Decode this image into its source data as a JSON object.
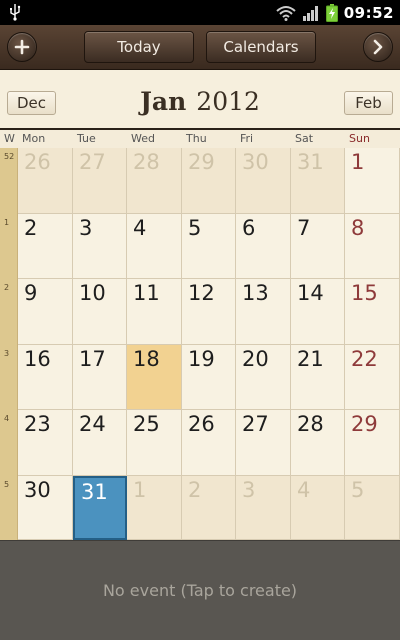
{
  "status_bar": {
    "time": "09:52"
  },
  "toolbar": {
    "today_label": "Today",
    "calendars_label": "Calendars"
  },
  "month_nav": {
    "prev": "Dec",
    "next": "Feb",
    "month": "Jan",
    "year": "2012"
  },
  "weekday_header": {
    "week": "W",
    "days": [
      "Mon",
      "Tue",
      "Wed",
      "Thu",
      "Fri",
      "Sat",
      "Sun"
    ]
  },
  "week_numbers": [
    "52",
    "1",
    "2",
    "3",
    "4",
    "5"
  ],
  "weeks": [
    [
      "26",
      "27",
      "28",
      "29",
      "30",
      "31",
      "1"
    ],
    [
      "2",
      "3",
      "4",
      "5",
      "6",
      "7",
      "8"
    ],
    [
      "9",
      "10",
      "11",
      "12",
      "13",
      "14",
      "15"
    ],
    [
      "16",
      "17",
      "18",
      "19",
      "20",
      "21",
      "22"
    ],
    [
      "23",
      "24",
      "25",
      "26",
      "27",
      "28",
      "29"
    ],
    [
      "30",
      "31",
      "1",
      "2",
      "3",
      "4",
      "5"
    ]
  ],
  "other_month_cells": [
    [
      0,
      0
    ],
    [
      0,
      1
    ],
    [
      0,
      2
    ],
    [
      0,
      3
    ],
    [
      0,
      4
    ],
    [
      0,
      5
    ],
    [
      5,
      2
    ],
    [
      5,
      3
    ],
    [
      5,
      4
    ],
    [
      5,
      5
    ],
    [
      5,
      6
    ]
  ],
  "today_cell": [
    3,
    2
  ],
  "selected_cell": [
    5,
    1
  ],
  "bottom": {
    "no_event": "No event (Tap to create)"
  },
  "colors": {
    "sunday": "#8e3a3a",
    "today": "#f2d291",
    "selected": "#4b92bf",
    "week_column": "#ddc88f"
  }
}
